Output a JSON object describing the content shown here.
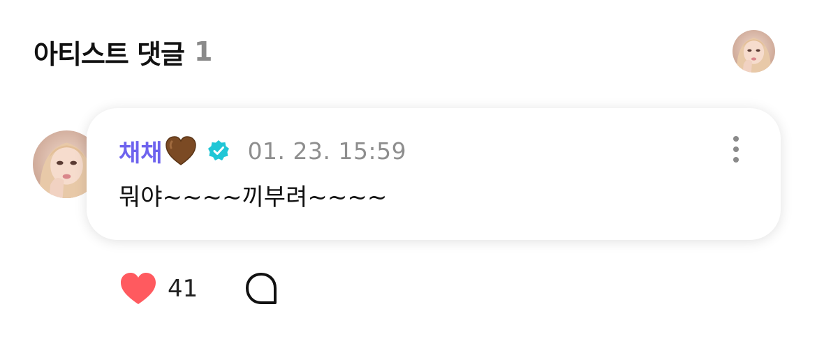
{
  "header": {
    "title": "아티스트 댓글",
    "count": "1"
  },
  "comment": {
    "author": "채채",
    "author_emoji": "brown-heart-icon",
    "verified_icon": "verified-badge-icon",
    "timestamp": "01. 23. 15:59",
    "text": "뭐야~~~~끼부려~~~~",
    "menu_icon": "more-vertical-icon"
  },
  "actions": {
    "like_icon": "heart-icon",
    "like_count": "41",
    "reply_icon": "speech-bubble-icon"
  },
  "colors": {
    "author_name": "#6e63ee",
    "verified_badge": "#20c6d6",
    "like_heart": "#ff5a5f",
    "timestamp": "#8e8e8e",
    "header_count": "#8a8a8a"
  }
}
